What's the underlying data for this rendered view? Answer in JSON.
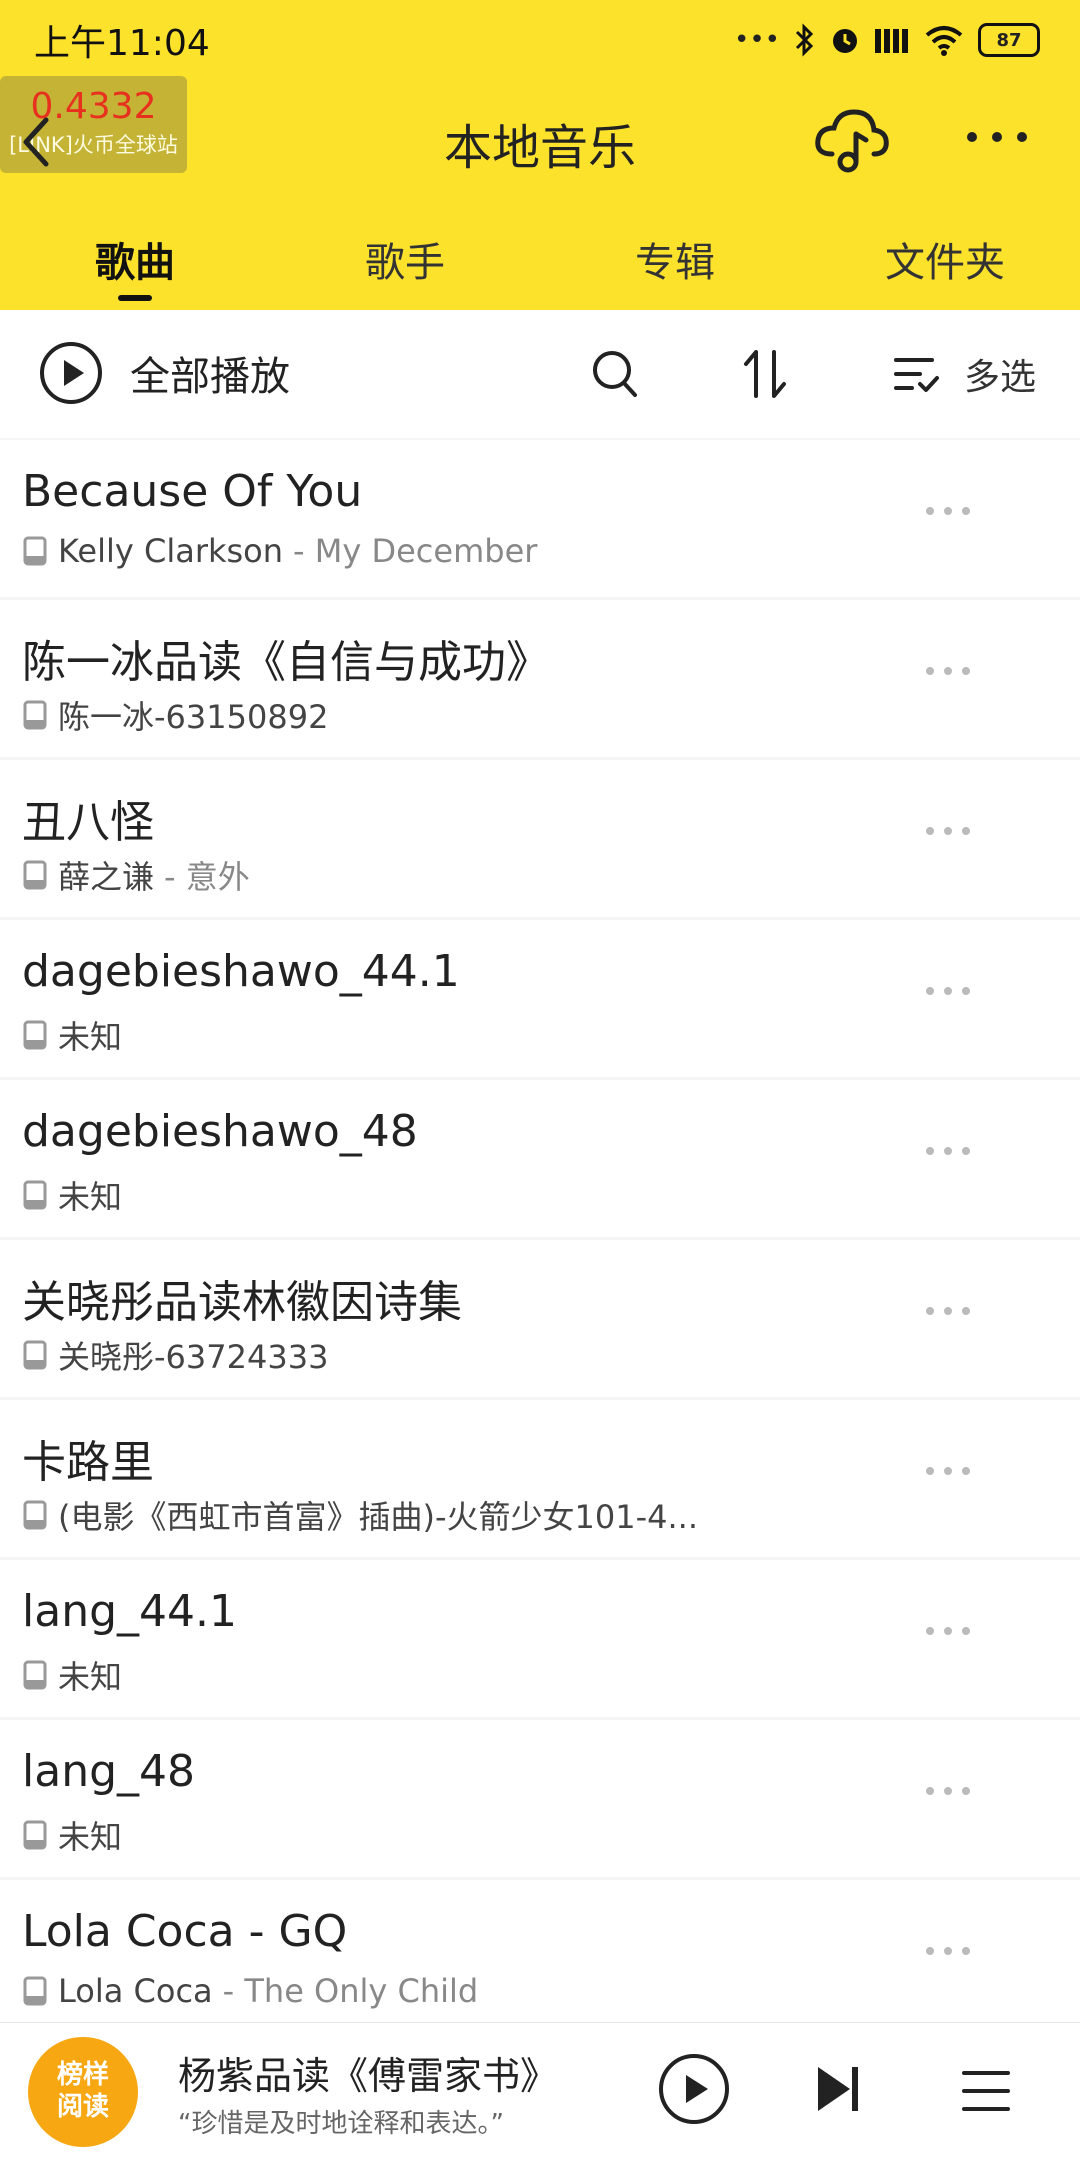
{
  "status": {
    "time": "上午11:04",
    "battery": "87"
  },
  "overlay": {
    "price": "0.4332",
    "source": "[LINK]火币全球站"
  },
  "header": {
    "title": "本地音乐"
  },
  "tabs": [
    {
      "label": "歌曲",
      "active": true
    },
    {
      "label": "歌手",
      "active": false
    },
    {
      "label": "专辑",
      "active": false
    },
    {
      "label": "文件夹",
      "active": false
    }
  ],
  "toolbar": {
    "play_all": "全部播放",
    "multi_select": "多选"
  },
  "songs": [
    {
      "title": "Because Of You",
      "artist": "Kelly Clarkson",
      "album": " - My December"
    },
    {
      "title": "陈一冰品读《自信与成功》",
      "artist": "陈一冰-63150892",
      "album": ""
    },
    {
      "title": "丑八怪",
      "artist": "薛之谦",
      "album": " - 意外"
    },
    {
      "title": "dagebieshawo_44.1",
      "artist": "未知",
      "album": ""
    },
    {
      "title": "dagebieshawo_48",
      "artist": "未知",
      "album": ""
    },
    {
      "title": "关晓彤品读林徽因诗集",
      "artist": "关晓彤-63724333",
      "album": ""
    },
    {
      "title": "卡路里",
      "artist": "(电影《西虹市首富》插曲)-火箭少女101-4...",
      "album": ""
    },
    {
      "title": "lang_44.1",
      "artist": "未知",
      "album": ""
    },
    {
      "title": "lang_48",
      "artist": "未知",
      "album": ""
    },
    {
      "title": "Lola Coca - GQ",
      "artist": "Lola Coca",
      "album": " - The Only Child"
    }
  ],
  "now_playing": {
    "cover_text_line1": "榜样",
    "cover_text_line2": "阅读",
    "title": "杨紫品读《傅雷家书》",
    "subtitle": "“珍惜是及时地诠释和表达。”"
  },
  "colors": {
    "accent": "#fde22c",
    "price": "#e8301f"
  },
  "icons": [
    "back-icon",
    "cloud-music-icon",
    "more-icon",
    "play-circle-icon",
    "search-icon",
    "sort-icon",
    "multi-select-icon",
    "local-file-icon",
    "row-more-icon",
    "next-icon",
    "playlist-icon"
  ]
}
